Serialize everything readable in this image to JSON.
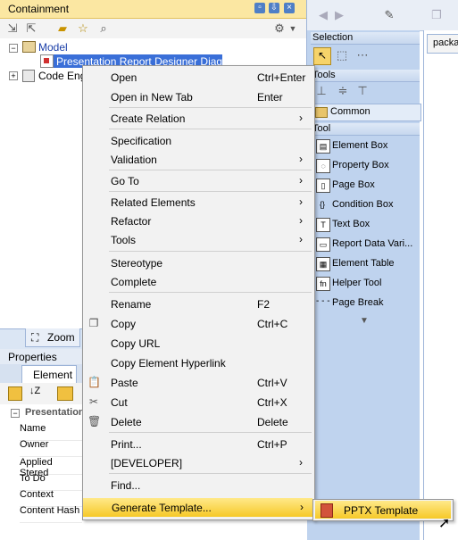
{
  "containment": {
    "title": "Containment",
    "tree": {
      "model": "Model",
      "diagram": "Presentation Report Designer Diagram",
      "code_engineering": "Code Eng"
    }
  },
  "zoom_tab": "Zoom",
  "properties": {
    "title": "Properties",
    "tab": "Element",
    "group": "Presentation",
    "rows": [
      "Name",
      "Owner",
      "Applied Stered",
      "To Do",
      "Context",
      "Content Hash"
    ]
  },
  "right_tab": "packa",
  "palette": {
    "selection": "Selection",
    "tools": "Tools",
    "common": "Common",
    "tool": "Tool",
    "items": [
      "Element Box",
      "Property Box",
      "Page Box",
      "Condition Box",
      "Text Box",
      "Report Data Vari...",
      "Element Table",
      "Helper Tool",
      "Page Break"
    ]
  },
  "menu": {
    "items": [
      {
        "label": "Open",
        "shortcut": "Ctrl+Enter"
      },
      {
        "label": "Open in New Tab",
        "shortcut": "Enter"
      },
      {
        "label": "Create Relation",
        "submenu": true
      },
      {
        "label": "Specification"
      },
      {
        "label": "Validation",
        "submenu": true
      },
      {
        "label": "Go To",
        "submenu": true
      },
      {
        "label": "Related Elements",
        "submenu": true
      },
      {
        "label": "Refactor",
        "submenu": true
      },
      {
        "label": "Tools",
        "submenu": true
      },
      {
        "label": "Stereotype"
      },
      {
        "label": "Complete"
      },
      {
        "label": "Rename",
        "shortcut": "F2"
      },
      {
        "label": "Copy",
        "shortcut": "Ctrl+C",
        "icon": "copy-icon"
      },
      {
        "label": "Copy URL"
      },
      {
        "label": "Copy Element Hyperlink"
      },
      {
        "label": "Paste",
        "shortcut": "Ctrl+V",
        "icon": "paste-icon"
      },
      {
        "label": "Cut",
        "shortcut": "Ctrl+X",
        "icon": "cut-icon"
      },
      {
        "label": "Delete",
        "shortcut": "Delete",
        "icon": "delete-icon"
      },
      {
        "label": "Print...",
        "shortcut": "Ctrl+P"
      },
      {
        "label": "[DEVELOPER]",
        "submenu": true
      },
      {
        "label": "Find..."
      },
      {
        "label": "Generate Template...",
        "submenu": true,
        "highlighted": true
      }
    ],
    "submenu_item": "PPTX Template"
  },
  "colors": {
    "title_bar": "#fbe7a2",
    "highlight": "#f6c928",
    "palette_bg": "#bfd3ee",
    "selection_blue": "#3a6fd8"
  }
}
